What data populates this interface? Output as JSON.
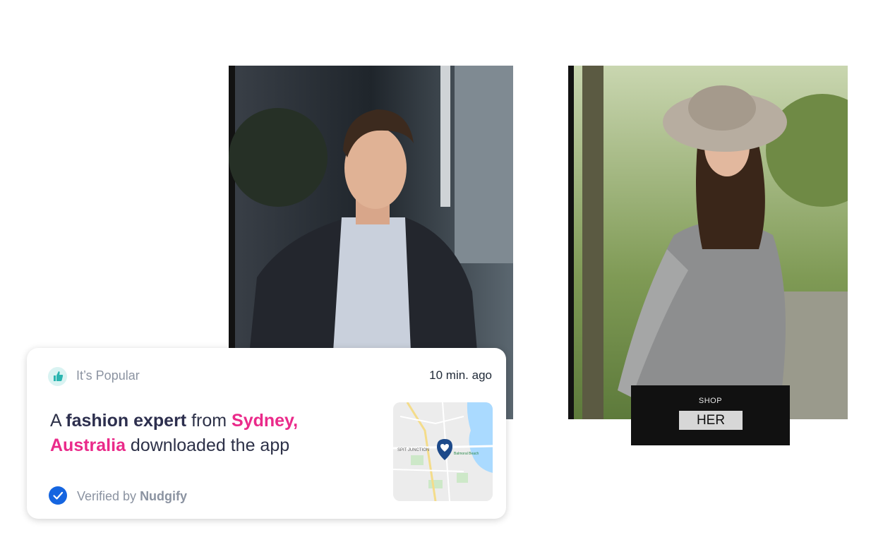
{
  "notification": {
    "category_label": "It’s Popular",
    "time_ago": "10 min. ago",
    "message": {
      "prefix": "A ",
      "person": "fashion expert",
      "middle": " from ",
      "location": "Sydney, Australia",
      "suffix": " downloaded the app"
    },
    "map_labels": {
      "junction": "SPIT JUNCTION",
      "beach": "Balmoral Beach"
    },
    "verified_prefix": "Verified by ",
    "verified_brand": "Nudgify",
    "icons": {
      "category": "thumbs-up-icon",
      "verified": "check-circle-icon",
      "map_pin": "heart-pin-icon"
    }
  },
  "shop": {
    "kicker": "SHOP",
    "button_label": "HER"
  },
  "colors": {
    "accent_pink": "#ea2a8a",
    "verified_blue": "#1565e0",
    "thumb_teal": "#2bb5b0"
  }
}
